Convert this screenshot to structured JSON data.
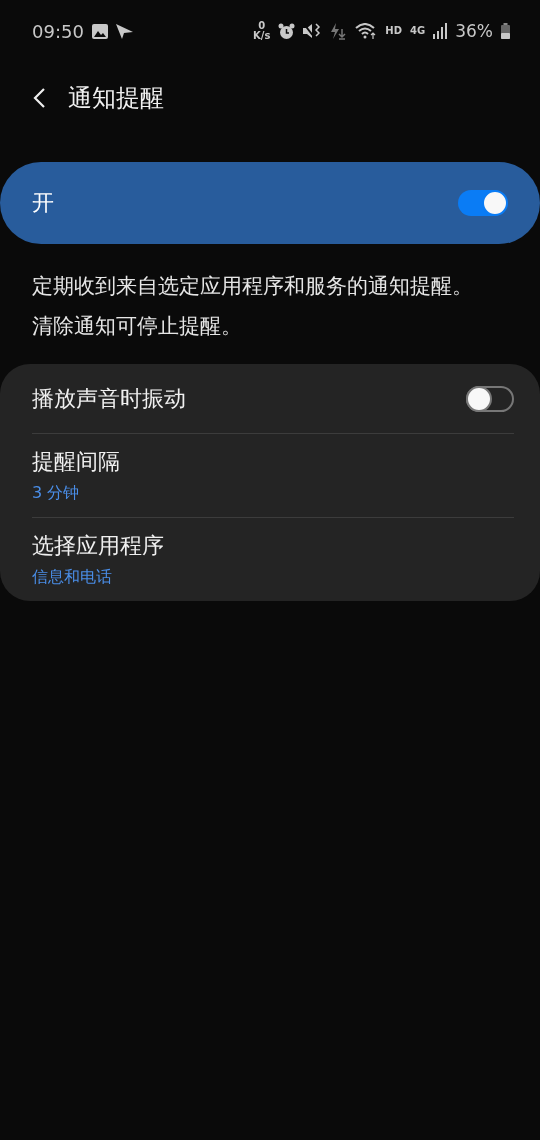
{
  "status_bar": {
    "time": "09:50",
    "speed_value": "0",
    "speed_unit": "K/s",
    "hd": "HD",
    "network": "4G",
    "battery": "36%"
  },
  "header": {
    "title": "通知提醒"
  },
  "master_switch": {
    "label": "开",
    "on": true
  },
  "description": "定期收到来自选定应用程序和服务的通知提醒。清除通知可停止提醒。",
  "settings": [
    {
      "kind": "toggle",
      "title": "播放声音时振动",
      "on": false
    },
    {
      "kind": "detail",
      "title": "提醒间隔",
      "value": "3 分钟"
    },
    {
      "kind": "detail",
      "title": "选择应用程序",
      "value": "信息和电话"
    }
  ]
}
